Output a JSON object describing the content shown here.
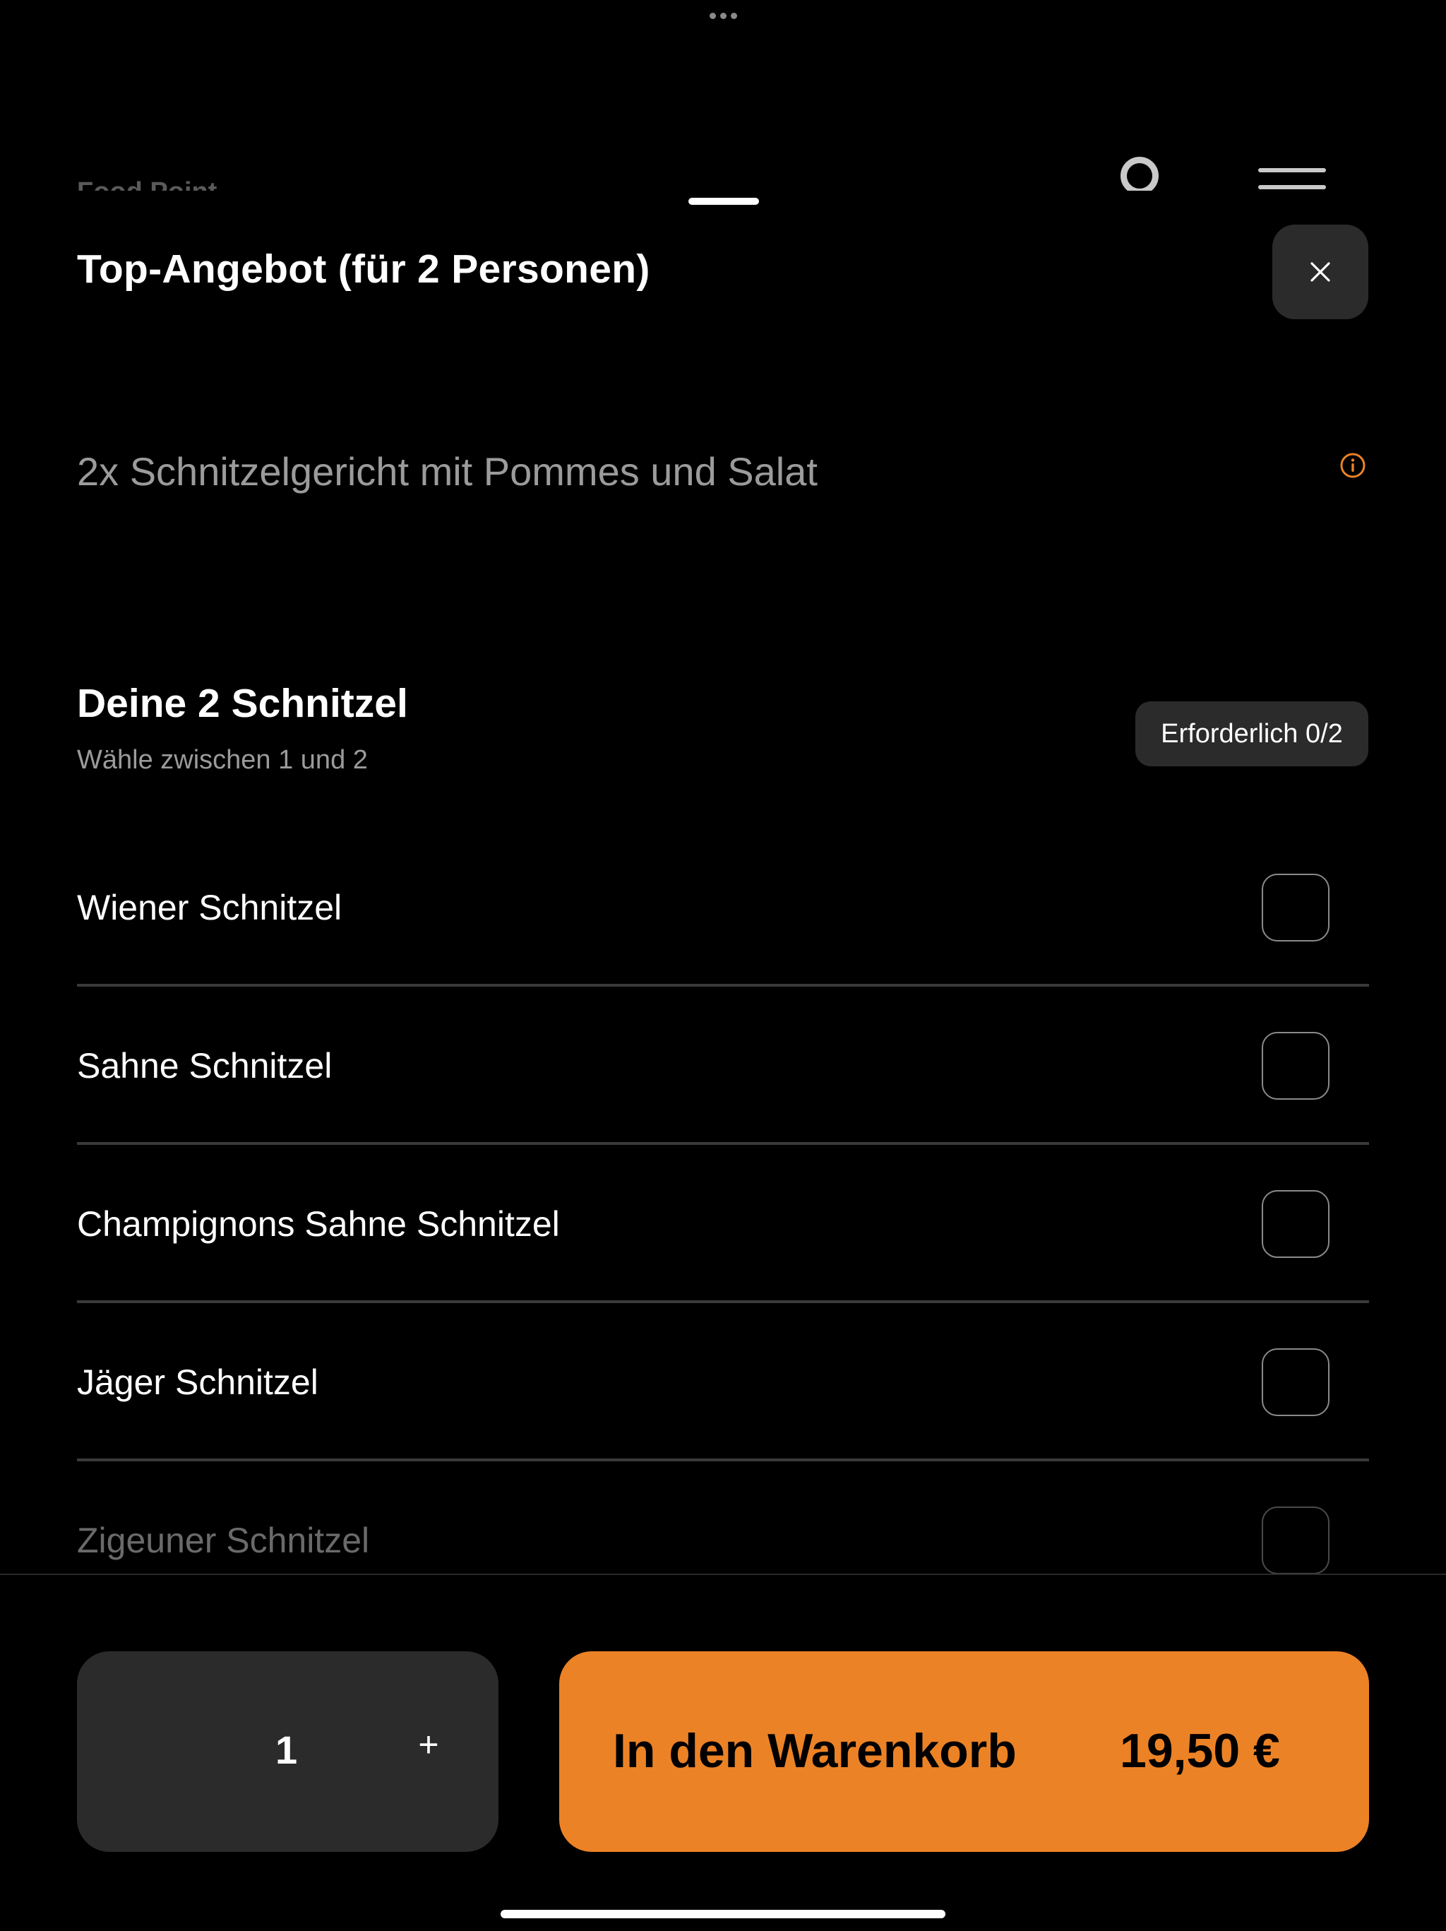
{
  "background": {
    "brand": "Food Point"
  },
  "sheet": {
    "title": "Top-Angebot (für 2 Personen)",
    "description": "2x Schnitzelgericht mit Pommes und Salat"
  },
  "group": {
    "title": "Deine 2 Schnitzel",
    "subtitle": "Wähle zwischen 1 und 2",
    "badge": "Erforderlich 0/2"
  },
  "options": [
    {
      "label": "Wiener Schnitzel",
      "checked": false
    },
    {
      "label": "Sahne Schnitzel",
      "checked": false
    },
    {
      "label": "Champignons Sahne Schnitzel",
      "checked": false
    },
    {
      "label": "Jäger Schnitzel",
      "checked": false
    },
    {
      "label": "Zigeuner Schnitzel",
      "checked": false
    }
  ],
  "footer": {
    "quantity": "1",
    "plus": "+",
    "cart_label": "In den Warenkorb",
    "price": "19,50 €"
  },
  "colors": {
    "accent": "#ec8226",
    "surface": "#2b2b2b",
    "background": "#000000"
  },
  "icons": {
    "close": "close-icon",
    "info": "info-icon",
    "plus": "plus-icon"
  }
}
